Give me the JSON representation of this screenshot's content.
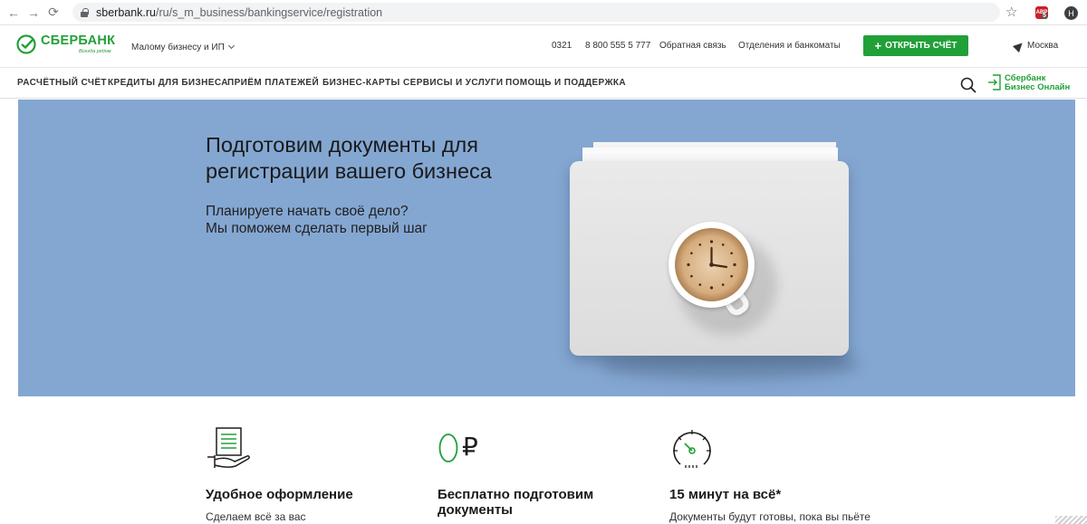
{
  "browser": {
    "url_host": "sberbank.ru",
    "url_path": "/ru/s_m_business/bankingservice/registration",
    "extension_badge": "ABP",
    "extension_count": "5",
    "profile_initial": "Н"
  },
  "header": {
    "logo_name": "СБЕРБАНК",
    "logo_slogan": "Всегда рядом",
    "segment": "Малому бизнесу и ИП",
    "short_number": "0321",
    "phone": "8 800 555 5 777",
    "feedback": "Обратная связь",
    "branches": "Отделения и банкоматы",
    "open_account": "ОТКРЫТЬ СЧЁТ",
    "city": "Москва"
  },
  "nav": {
    "items": [
      "РАСЧЁТНЫЙ СЧЁТ",
      "КРЕДИТЫ ДЛЯ БИЗНЕСА",
      "ПРИЁМ ПЛАТЕЖЕЙ",
      "БИЗНЕС-КАРТЫ",
      "СЕРВИСЫ И УСЛУГИ",
      "ПОМОЩЬ И ПОДДЕРЖКА"
    ],
    "sbol_line1": "Сбербанк",
    "sbol_line2": "Бизнес Онлайн"
  },
  "hero": {
    "title_line1": "Подготовим документы для",
    "title_line2": "регистрации вашего бизнеса",
    "sub_line1": "Планируете начать своё дело?",
    "sub_line2": "Мы поможем сделать первый шаг",
    "background": "#84a7d2"
  },
  "features": [
    {
      "icon": "document-hand-icon",
      "title_line1": "Удобное оформление",
      "title_line2": "",
      "text": "Сделаем всё за вас"
    },
    {
      "icon": "zero-ruble-icon",
      "title_line1": "Бесплатно подготовим",
      "title_line2": "документы",
      "text": "",
      "ruble": "₽"
    },
    {
      "icon": "stopwatch-icon",
      "title_line1": "15 минут на всё*",
      "title_line2": "",
      "text": "Документы будут готовы, пока вы пьёте"
    }
  ],
  "colors": {
    "brand_green": "#21a038",
    "hero_blue": "#84a7d2"
  }
}
